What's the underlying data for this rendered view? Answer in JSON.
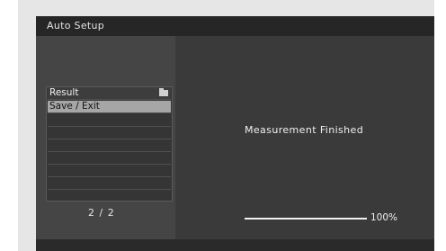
{
  "title": "Auto Setup",
  "menu": {
    "items": [
      {
        "label": "Result",
        "icon": "folder-icon"
      },
      {
        "label": "Save / Exit"
      }
    ],
    "page_indicator": "2 / 2"
  },
  "status": {
    "message": "Measurement Finished",
    "progress_fraction": 1.0,
    "progress_label": "100%"
  }
}
